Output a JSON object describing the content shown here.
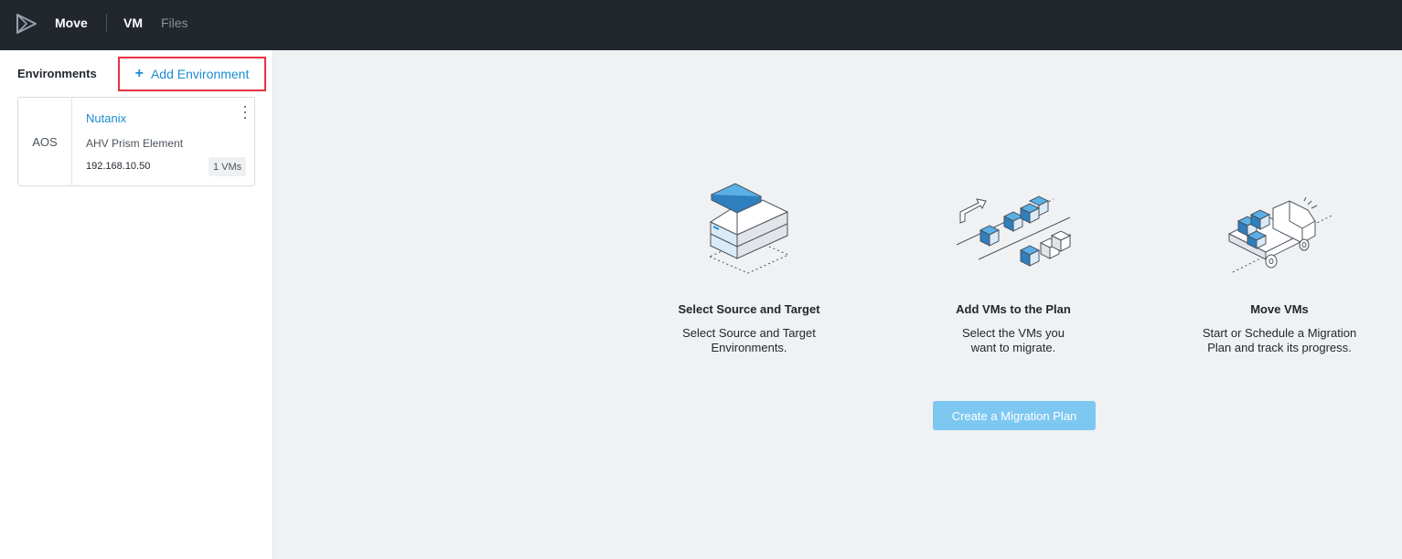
{
  "header": {
    "app_name": "Move",
    "nav": {
      "vm": "VM",
      "files": "Files"
    }
  },
  "sidebar": {
    "title": "Environments",
    "add_button": {
      "icon": "+",
      "label": "Add Environment"
    },
    "environments": [
      {
        "type": "AOS",
        "name": "Nutanix",
        "subtitle": "AHV Prism Element",
        "ip": "192.168.10.50",
        "vm_count": "1 VMs"
      }
    ]
  },
  "steps": [
    {
      "icon": "source-target-illustration",
      "title": "Select Source and Target",
      "desc_line1": "Select Source and Target",
      "desc_line2": "Environments."
    },
    {
      "icon": "add-vms-illustration",
      "title": "Add VMs to the Plan",
      "desc_line1": "Select the VMs you",
      "desc_line2": "want to migrate."
    },
    {
      "icon": "move-vms-truck-illustration",
      "title": "Move VMs",
      "desc_line1": "Start or Schedule a Migration",
      "desc_line2": "Plan and track its progress."
    }
  ],
  "create_button": {
    "label": "Create a Migration Plan"
  },
  "colors": {
    "topbar": "#22272e",
    "accent": "#1b8ccf",
    "highlight_border": "#e8333d",
    "create_button": "#7dc8f1"
  }
}
